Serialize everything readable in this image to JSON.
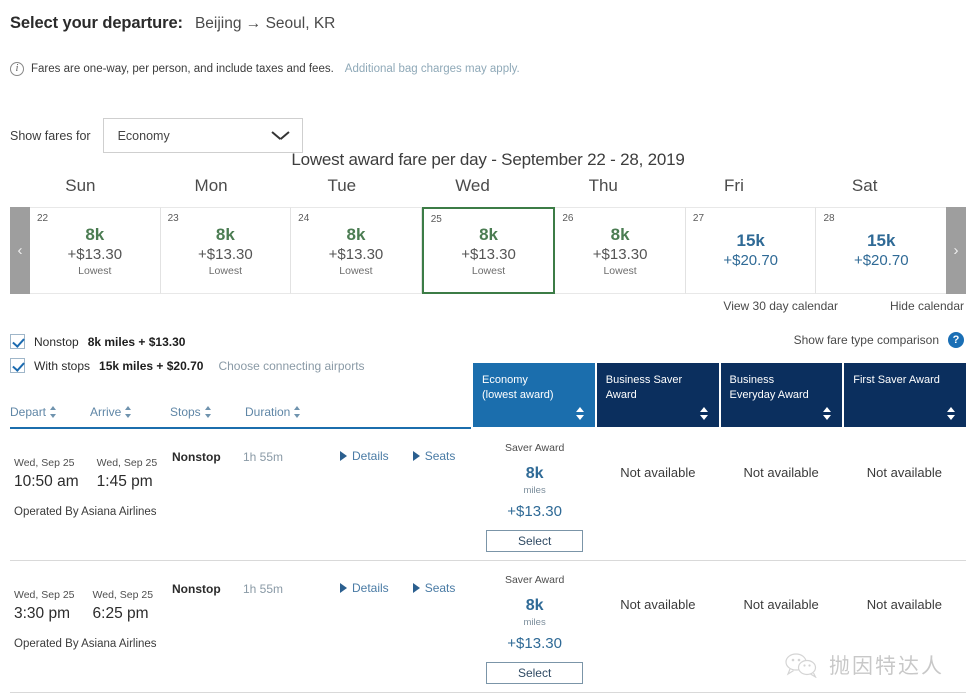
{
  "header": {
    "title": "Select your departure:",
    "route": "Beijing → Seoul, KR",
    "info_text": "Fares are one-way, per person, and include taxes and fees.",
    "info_link": "Additional bag charges may apply."
  },
  "fare_filter": {
    "label": "Show fares for",
    "selected": "Economy"
  },
  "calendar": {
    "title": "Lowest award fare per day - September 22 - 28, 2019",
    "dow": [
      "Sun",
      "Mon",
      "Tue",
      "Wed",
      "Thu",
      "Fri",
      "Sat"
    ],
    "prev_label": "‹",
    "next_label": "›",
    "days": [
      {
        "day": "22",
        "miles": "8k",
        "cash": "+$13.30",
        "note": "Lowest",
        "tone": "green",
        "selected": false
      },
      {
        "day": "23",
        "miles": "8k",
        "cash": "+$13.30",
        "note": "Lowest",
        "tone": "green",
        "selected": false
      },
      {
        "day": "24",
        "miles": "8k",
        "cash": "+$13.30",
        "note": "Lowest",
        "tone": "green",
        "selected": false
      },
      {
        "day": "25",
        "miles": "8k",
        "cash": "+$13.30",
        "note": "Lowest",
        "tone": "green",
        "selected": true
      },
      {
        "day": "26",
        "miles": "8k",
        "cash": "+$13.30",
        "note": "Lowest",
        "tone": "green",
        "selected": false
      },
      {
        "day": "27",
        "miles": "15k",
        "cash": "+$20.70",
        "note": "",
        "tone": "blue",
        "selected": false
      },
      {
        "day": "28",
        "miles": "15k",
        "cash": "+$20.70",
        "note": "",
        "tone": "blue",
        "selected": false
      }
    ],
    "view_30_day": "View 30 day calendar",
    "hide_calendar": "Hide calendar"
  },
  "filters": {
    "nonstop": {
      "label": "Nonstop",
      "value": "8k miles + $13.30",
      "checked": true
    },
    "withstops": {
      "label": "With stops",
      "value": "15k miles + $20.70",
      "checked": true,
      "link": "Choose connecting airports"
    },
    "comparison_label": "Show fare type comparison",
    "help_icon": "?"
  },
  "sort": {
    "columns": [
      "Depart",
      "Arrive",
      "Stops",
      "Duration"
    ]
  },
  "fare_columns": [
    {
      "line1": "Economy",
      "line2": "(lowest award)",
      "active": true
    },
    {
      "line1": "Business Saver",
      "line2": "Award",
      "active": false
    },
    {
      "line1": "Business",
      "line2": "Everyday Award",
      "active": false
    },
    {
      "line1": "First Saver Award",
      "line2": "",
      "active": false
    }
  ],
  "flights": [
    {
      "depart_date": "Wed, Sep 25",
      "depart_time": "10:50 am",
      "arrive_date": "Wed, Sep 25",
      "arrive_time": "1:45 pm",
      "stops": "Nonstop",
      "duration": "1h 55m",
      "details_label": "Details",
      "seats_label": "Seats",
      "operated": "Operated By Asiana Airlines",
      "fares": [
        {
          "available": true,
          "type": "Saver Award",
          "miles": "8k",
          "miles_unit": "miles",
          "cash": "+$13.30",
          "button": "Select"
        },
        {
          "available": false,
          "na": "Not available"
        },
        {
          "available": false,
          "na": "Not available"
        },
        {
          "available": false,
          "na": "Not available"
        }
      ]
    },
    {
      "depart_date": "Wed, Sep 25",
      "depart_time": "3:30 pm",
      "arrive_date": "Wed, Sep 25",
      "arrive_time": "6:25 pm",
      "stops": "Nonstop",
      "duration": "1h 55m",
      "details_label": "Details",
      "seats_label": "Seats",
      "operated": "Operated By Asiana Airlines",
      "fares": [
        {
          "available": true,
          "type": "Saver Award",
          "miles": "8k",
          "miles_unit": "miles",
          "cash": "+$13.30",
          "button": "Select"
        },
        {
          "available": false,
          "na": "Not available"
        },
        {
          "available": false,
          "na": "Not available"
        },
        {
          "available": false,
          "na": "Not available"
        }
      ]
    }
  ],
  "watermark": {
    "text": "抛因特达人"
  },
  "colors": {
    "accent_blue": "#1b6ead",
    "header_navy": "#0b2f5e",
    "award_green": "#4b7c52",
    "award_blue": "#2f6a96",
    "selected_border": "#3c7c46"
  }
}
